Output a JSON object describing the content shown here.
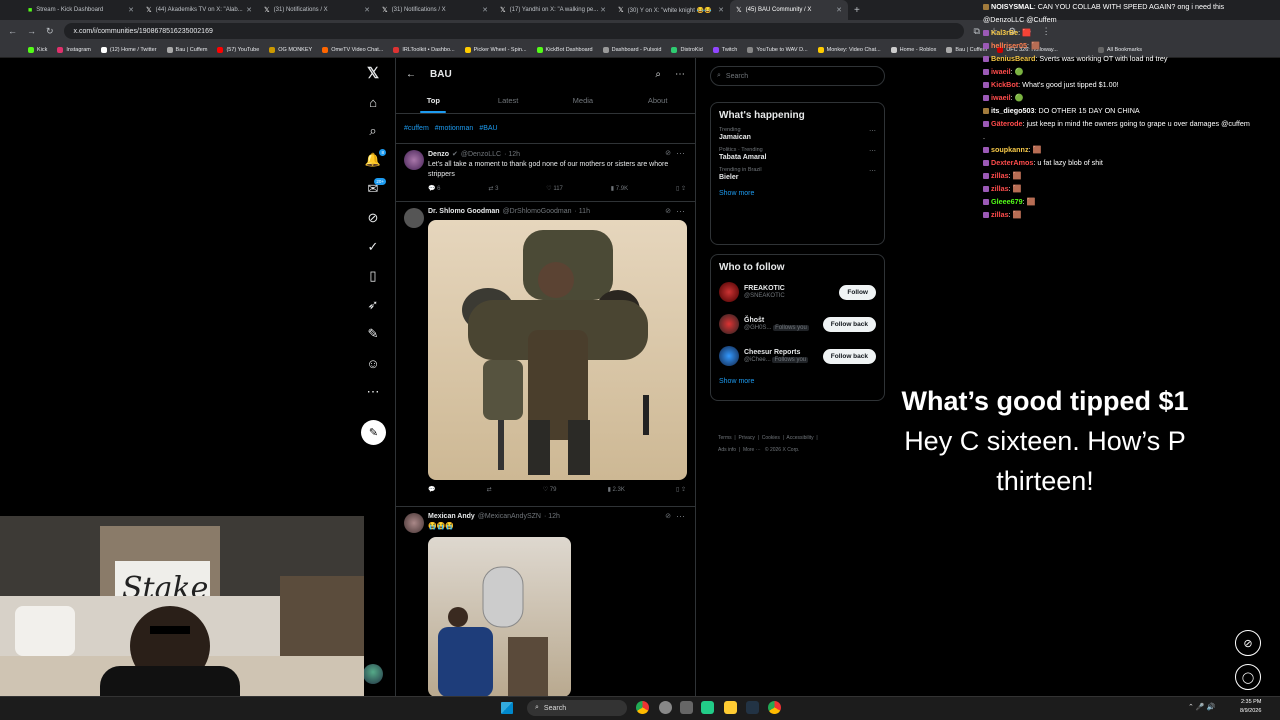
{
  "browser": {
    "tabs": [
      {
        "label": "Stream - Kick Dashboard",
        "active": false
      },
      {
        "label": "(44) Akademiks TV on X: \"Alab...",
        "active": false
      },
      {
        "label": "(31) Notifications / X",
        "active": false
      },
      {
        "label": "(31) Notifications / X",
        "active": false
      },
      {
        "label": "(17) Yandhi on X: \"A walking pe...",
        "active": false
      },
      {
        "label": "(30) Y on X: \"white knight 😂😂",
        "active": false
      },
      {
        "label": "(45) BAU Community / X",
        "active": true
      }
    ],
    "url": "x.com/i/communities/1908678516235002169",
    "bookmarks": [
      "Kick",
      "Instagram",
      "(12) Home / Twitter",
      "Bau | Cuffem",
      "(57) YouTube",
      "OG MONKEY",
      "OmeTV Video Chat...",
      "IRLToolkit • Dashbo...",
      "Picker Wheel - Spin...",
      "KickBot Dashboard",
      "Dashboard - Pulsoid",
      "DistroKid",
      "Twitch",
      "YouTube to WAV D...",
      "Monkey: Video Chat...",
      "Home - Roblox",
      "Bau | Cuffem",
      "UFC 326: Holloway...",
      "All Bookmarks"
    ]
  },
  "xnav": {
    "items": [
      "x-logo-icon",
      "home-icon",
      "search-icon",
      "bell-icon",
      "messages-icon",
      "grok-icon",
      "communities-icon",
      "bookmark-icon",
      "jobs-icon",
      "premium-icon",
      "profile-icon",
      "more-icon"
    ],
    "notif_badge": "8",
    "msg_badge": "20+"
  },
  "community": {
    "title": "BAU",
    "tabs": [
      "Top",
      "Latest",
      "Media",
      "About"
    ],
    "hashtags": [
      "#cuffem",
      "#motionman",
      "#BAU"
    ]
  },
  "posts": [
    {
      "name": "Denzo",
      "handle": "@DenzoLLC",
      "time": "· 12h",
      "text": "Let's all take a moment to thank god none of our mothers or sisters are whore strippers",
      "replies": "6",
      "reposts": "3",
      "likes": "117",
      "views": "7.9K"
    },
    {
      "name": "Dr. Shlomo Goodman",
      "handle": "@DrShlomoGoodman",
      "time": "· 11h",
      "text": "",
      "replies": "",
      "reposts": "",
      "likes": "79",
      "views": "2.3K"
    },
    {
      "name": "Mexican Andy",
      "handle": "@MexicanAndySZN",
      "time": "· 12h",
      "text": "😭😭😭"
    }
  ],
  "sidebar": {
    "search_placeholder": "Search",
    "happening_title": "What's happening",
    "trends": [
      {
        "context": "Trending",
        "name": "Jamaican"
      },
      {
        "context": "Politics · Trending",
        "name": "Tabata Amaral"
      },
      {
        "context": "Trending in Brazil",
        "name": "Bieler"
      }
    ],
    "show_more": "Show more",
    "who_title": "Who to follow",
    "who": [
      {
        "name": "FREAKOTIC",
        "handle": "@SNEAKOTIC",
        "button": "Follow",
        "follows_you": ""
      },
      {
        "name": "Ğhoŝt",
        "handle": "@GH0S...",
        "button": "Follow back",
        "follows_you": "Follows you"
      },
      {
        "name": "Cheesur Reports",
        "handle": "@iChee...",
        "button": "Follow back",
        "follows_you": "Follows you"
      }
    ],
    "footer": [
      "Terms",
      "Privacy",
      "Cookies",
      "Accessibility",
      "Ads info",
      "More ···",
      "© 2026 X Corp."
    ]
  },
  "chat": [
    {
      "user": "NOISYSMAL",
      "color": "#ffffff",
      "msg": "CAN YOU COLLAB WITH SPEED AGAIN? ong i need this @DenzoLLC @Cuffem"
    },
    {
      "user": "Kal3rBe",
      "color": "#f7c948",
      "msg": "🟥"
    },
    {
      "user": "hellriser05",
      "color": "#ff7f50",
      "msg": "🟫"
    },
    {
      "user": "BeniusBeard",
      "color": "#f7c948",
      "msg": "Sverts was working OT with load nd trey"
    },
    {
      "user": "iwaeil",
      "color": "#ff4c4c",
      "msg": "🟢"
    },
    {
      "user": "KickBot",
      "color": "#ff4c4c",
      "msg": "What's good just tipped $1.00!"
    },
    {
      "user": "iwaeil",
      "color": "#ff4c4c",
      "msg": "🟢"
    },
    {
      "user": "its_diego503",
      "color": "#ffffff",
      "msg": "DO OTHER 15 DAY ON CHINA"
    },
    {
      "user": "Gäterode",
      "color": "#ff4c4c",
      "msg": "just keep in mind the owners going to grape u over damages @cuffem ."
    },
    {
      "user": "soupkannz",
      "color": "#f7c948",
      "msg": "🟫"
    },
    {
      "user": "DexterAmos",
      "color": "#ff4c4c",
      "msg": "u fat lazy blob of shit"
    },
    {
      "user": "zillas",
      "color": "#ff4c4c",
      "msg": "🟫"
    },
    {
      "user": "zillas",
      "color": "#ff4c4c",
      "msg": "🟫"
    },
    {
      "user": "Gleee679",
      "color": "#53fc18",
      "msg": "🟫"
    },
    {
      "user": "zillas",
      "color": "#ff4c4c",
      "msg": "🟫"
    }
  ],
  "tip": {
    "headline": "What’s good tipped $1",
    "message": "Hey C sixteen. How’s P thirteen!"
  },
  "taskbar": {
    "search": "Search",
    "time": "2:35 PM",
    "date": "8/9/2026"
  },
  "colors": {
    "accent": "#1d9bf0",
    "bg": "#000000",
    "border": "#2f3336",
    "muted": "#71767b"
  }
}
